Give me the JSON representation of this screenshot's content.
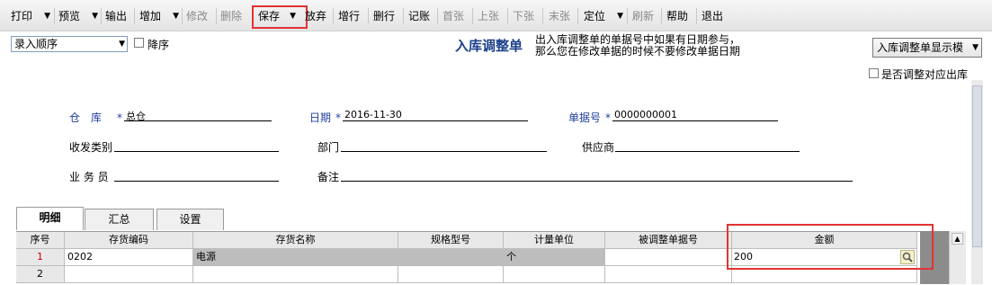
{
  "toolbar": {
    "items": [
      {
        "label": "打印",
        "disabled": false,
        "dropdown": true
      },
      {
        "label": "预览",
        "disabled": false,
        "dropdown": true
      },
      {
        "label": "输出",
        "disabled": false,
        "dropdown": false
      },
      {
        "label": "增加",
        "disabled": false,
        "dropdown": true
      },
      {
        "label": "修改",
        "disabled": true,
        "dropdown": false
      },
      {
        "label": "删除",
        "disabled": true,
        "dropdown": false
      },
      {
        "label": "保存",
        "disabled": false,
        "dropdown": true
      },
      {
        "label": "放弃",
        "disabled": false,
        "dropdown": false
      },
      {
        "label": "增行",
        "disabled": false,
        "dropdown": false
      },
      {
        "label": "删行",
        "disabled": false,
        "dropdown": false
      },
      {
        "label": "记账",
        "disabled": false,
        "dropdown": false
      },
      {
        "label": "首张",
        "disabled": true,
        "dropdown": false
      },
      {
        "label": "上张",
        "disabled": true,
        "dropdown": false
      },
      {
        "label": "下张",
        "disabled": true,
        "dropdown": false
      },
      {
        "label": "末张",
        "disabled": true,
        "dropdown": false
      },
      {
        "label": "定位",
        "disabled": false,
        "dropdown": true
      },
      {
        "label": "刷新",
        "disabled": true,
        "dropdown": false
      },
      {
        "label": "帮助",
        "disabled": false,
        "dropdown": false
      },
      {
        "label": "退出",
        "disabled": false,
        "dropdown": false
      }
    ]
  },
  "order_select": {
    "value": "录入顺序"
  },
  "descending": {
    "label": "降序",
    "checked": false
  },
  "form_title": "入库调整单",
  "hint": {
    "line1": "出入库调整单的单据号中如果有日期参与，",
    "line2": "那么您在修改单据的时候不要修改单据日期"
  },
  "display_template": {
    "value": "入库调整单显示模"
  },
  "adjust_outbound": {
    "label": "是否调整对应出库",
    "checked": false
  },
  "fields": {
    "warehouse": {
      "label": "仓　库",
      "required_mark": "*",
      "value": "总仓"
    },
    "date": {
      "label": "日期",
      "required_mark": "*",
      "value": "2016-11-30"
    },
    "doc_no": {
      "label": "单据号",
      "required_mark": "*",
      "value": "0000000001"
    },
    "category": {
      "label": "收发类别",
      "value": ""
    },
    "department": {
      "label": "部门",
      "value": ""
    },
    "supplier": {
      "label": "供应商",
      "value": ""
    },
    "salesman": {
      "label": "业 务 员",
      "value": ""
    },
    "remark": {
      "label": "备注",
      "value": ""
    }
  },
  "tabs": [
    {
      "label": "明细",
      "active": true
    },
    {
      "label": "汇总",
      "active": false
    },
    {
      "label": "设置",
      "active": false
    }
  ],
  "grid": {
    "columns": [
      "序号",
      "存货编码",
      "存货名称",
      "规格型号",
      "计量单位",
      "被调整单据号",
      "金额"
    ],
    "rows": [
      {
        "no": "1",
        "code": "0202",
        "name": "电源",
        "spec": "",
        "unit": "个",
        "ref": "",
        "amount": "200"
      },
      {
        "no": "2",
        "code": "",
        "name": "",
        "spec": "",
        "unit": "",
        "ref": "",
        "amount": ""
      }
    ]
  },
  "colors": {
    "highlight": "#e23333",
    "title": "#1b3f8b",
    "label_blue": "#1f3fa0"
  },
  "icons": {
    "amount_lookup": "magnifier-icon"
  }
}
